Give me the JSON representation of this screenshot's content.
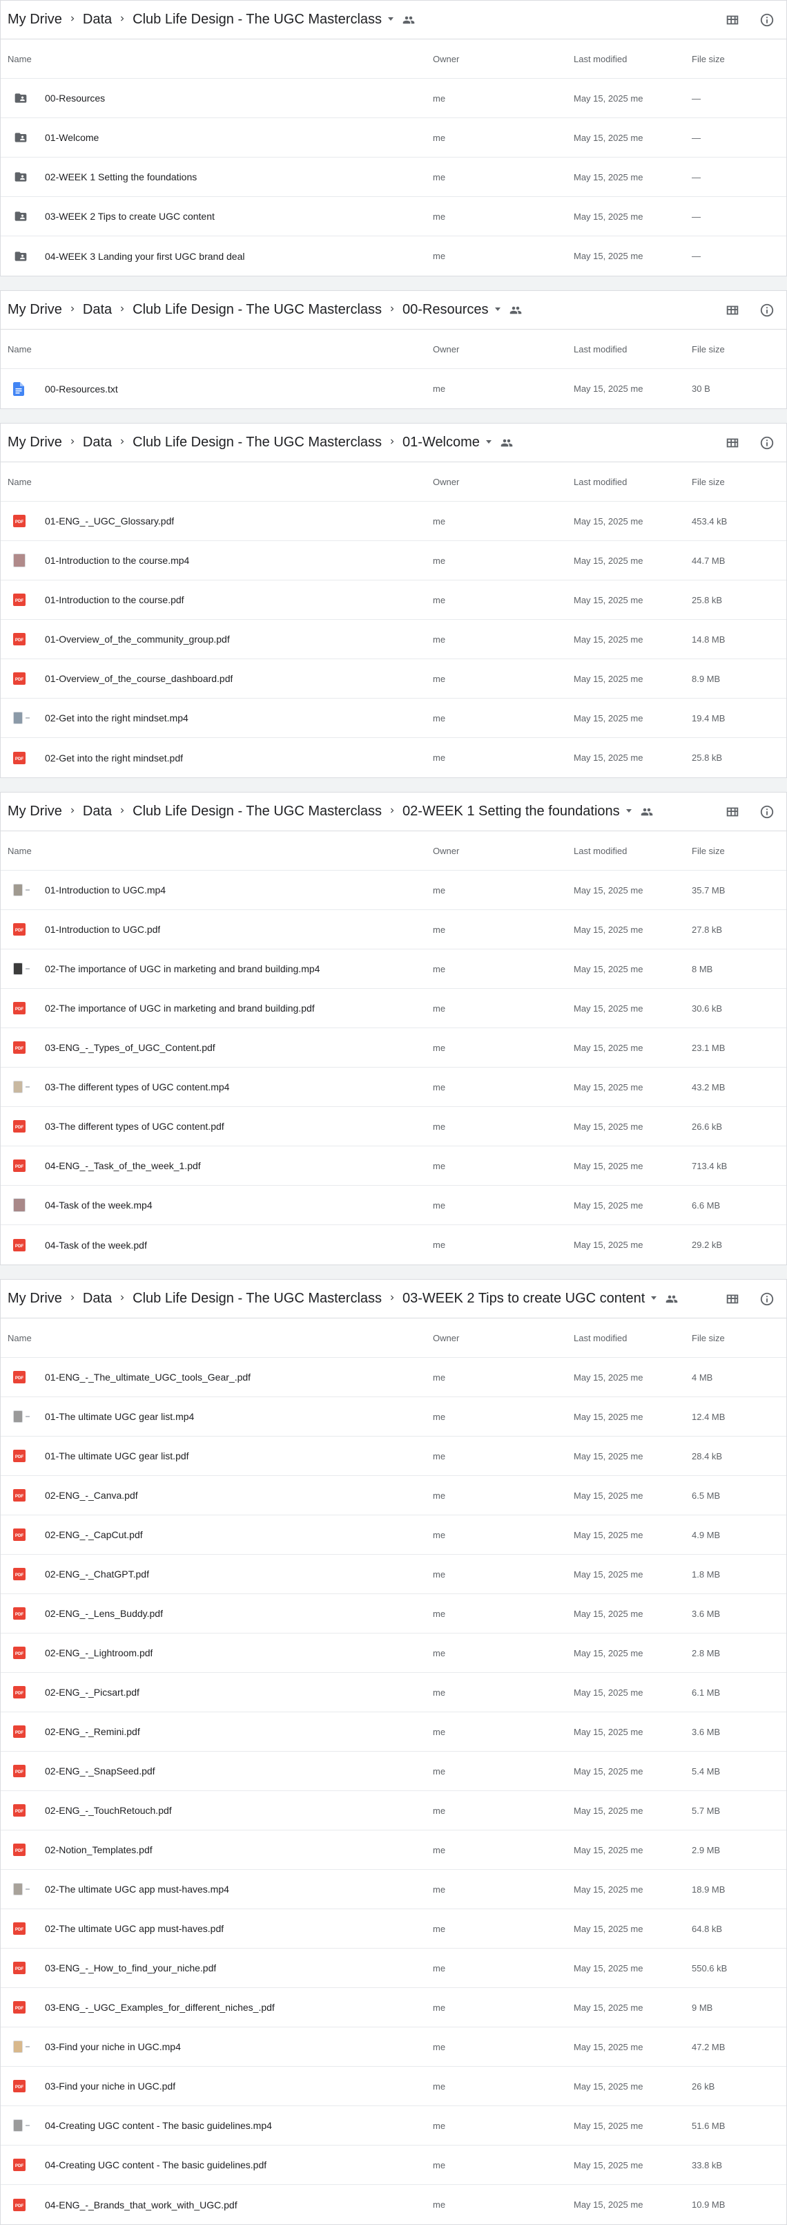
{
  "colors": {
    "pdf": "#ea4335",
    "doc": "#4285f4",
    "folder": "#5f6368",
    "text": "#202124",
    "muted": "#5f6368",
    "border": "#dadce0"
  },
  "columns": {
    "name": "Name",
    "owner": "Owner",
    "modified": "Last modified",
    "size": "File size"
  },
  "panels": [
    {
      "crumbs": [
        "My Drive",
        "Data",
        "Club Life Design - The UGC Masterclass"
      ],
      "files": [
        {
          "name": "00-Resources",
          "owner": "me",
          "modified": "May 15, 2025 me",
          "size": "—",
          "icon": "folder-shared-icon"
        },
        {
          "name": "01-Welcome",
          "owner": "me",
          "modified": "May 15, 2025 me",
          "size": "—",
          "icon": "folder-shared-icon"
        },
        {
          "name": "02-WEEK 1 Setting the foundations",
          "owner": "me",
          "modified": "May 15, 2025 me",
          "size": "—",
          "icon": "folder-shared-icon"
        },
        {
          "name": "03-WEEK 2 Tips to create UGC content",
          "owner": "me",
          "modified": "May 15, 2025 me",
          "size": "—",
          "icon": "folder-shared-icon"
        },
        {
          "name": "04-WEEK 3 Landing your first UGC brand deal",
          "owner": "me",
          "modified": "May 15, 2025 me",
          "size": "—",
          "icon": "folder-shared-icon"
        }
      ]
    },
    {
      "crumbs": [
        "My Drive",
        "Data",
        "Club Life Design - The UGC Masterclass",
        "00-Resources"
      ],
      "files": [
        {
          "name": "00-Resources.txt",
          "owner": "me",
          "modified": "May 15, 2025 me",
          "size": "30 B",
          "icon": "doc-icon"
        }
      ]
    },
    {
      "crumbs": [
        "My Drive",
        "Data",
        "Club Life Design - The UGC Masterclass",
        "01-Welcome"
      ],
      "files": [
        {
          "name": "01-ENG_-_UGC_Glossary.pdf",
          "owner": "me",
          "modified": "May 15, 2025 me",
          "size": "453.4 kB",
          "icon": "pdf-icon"
        },
        {
          "name": "01-Introduction to the course.mp4",
          "owner": "me",
          "modified": "May 15, 2025 me",
          "size": "44.7 MB",
          "icon": "video-thumb-icon",
          "thumb": "#b08a8a"
        },
        {
          "name": "01-Introduction to the course.pdf",
          "owner": "me",
          "modified": "May 15, 2025 me",
          "size": "25.8 kB",
          "icon": "pdf-icon"
        },
        {
          "name": "01-Overview_of_the_community_group.pdf",
          "owner": "me",
          "modified": "May 15, 2025 me",
          "size": "14.8 MB",
          "icon": "pdf-icon"
        },
        {
          "name": "01-Overview_of_the_course_dashboard.pdf",
          "owner": "me",
          "modified": "May 15, 2025 me",
          "size": "8.9 MB",
          "icon": "pdf-icon"
        },
        {
          "name": "02-Get into the right mindset.mp4",
          "owner": "me",
          "modified": "May 15, 2025 me",
          "size": "19.4 MB",
          "icon": "video-thumb-wide-icon",
          "thumb": "#8b9aa8"
        },
        {
          "name": "02-Get into the right mindset.pdf",
          "owner": "me",
          "modified": "May 15, 2025 me",
          "size": "25.8 kB",
          "icon": "pdf-icon"
        }
      ]
    },
    {
      "crumbs": [
        "My Drive",
        "Data",
        "Club Life Design - The UGC Masterclass",
        "02-WEEK 1 Setting the foundations"
      ],
      "files": [
        {
          "name": "01-Introduction to UGC.mp4",
          "owner": "me",
          "modified": "May 15, 2025 me",
          "size": "35.7 MB",
          "icon": "video-thumb-wide-icon",
          "thumb": "#a09a90"
        },
        {
          "name": "01-Introduction to UGC.pdf",
          "owner": "me",
          "modified": "May 15, 2025 me",
          "size": "27.8 kB",
          "icon": "pdf-icon"
        },
        {
          "name": "02-The importance of UGC in marketing and brand building.mp4",
          "owner": "me",
          "modified": "May 15, 2025 me",
          "size": "8 MB",
          "icon": "video-thumb-wide-icon",
          "thumb": "#3c3c3c"
        },
        {
          "name": "02-The importance of UGC in marketing and brand building.pdf",
          "owner": "me",
          "modified": "May 15, 2025 me",
          "size": "30.6 kB",
          "icon": "pdf-icon"
        },
        {
          "name": "03-ENG_-_Types_of_UGC_Content.pdf",
          "owner": "me",
          "modified": "May 15, 2025 me",
          "size": "23.1 MB",
          "icon": "pdf-icon"
        },
        {
          "name": "03-The different types of UGC content.mp4",
          "owner": "me",
          "modified": "May 15, 2025 me",
          "size": "43.2 MB",
          "icon": "video-thumb-wide-icon",
          "thumb": "#c8b8a0"
        },
        {
          "name": "03-The different types of UGC content.pdf",
          "owner": "me",
          "modified": "May 15, 2025 me",
          "size": "26.6 kB",
          "icon": "pdf-icon"
        },
        {
          "name": "04-ENG_-_Task_of_the_week_1.pdf",
          "owner": "me",
          "modified": "May 15, 2025 me",
          "size": "713.4 kB",
          "icon": "pdf-icon"
        },
        {
          "name": "04-Task of the week.mp4",
          "owner": "me",
          "modified": "May 15, 2025 me",
          "size": "6.6 MB",
          "icon": "video-thumb-icon",
          "thumb": "#a88888"
        },
        {
          "name": "04-Task of the week.pdf",
          "owner": "me",
          "modified": "May 15, 2025 me",
          "size": "29.2 kB",
          "icon": "pdf-icon"
        }
      ]
    },
    {
      "crumbs": [
        "My Drive",
        "Data",
        "Club Life Design - The UGC Masterclass",
        "03-WEEK 2 Tips to create UGC content"
      ],
      "files": [
        {
          "name": "01-ENG_-_The_ultimate_UGC_tools_Gear_.pdf",
          "owner": "me",
          "modified": "May 15, 2025 me",
          "size": "4 MB",
          "icon": "pdf-icon"
        },
        {
          "name": "01-The ultimate UGC gear list.mp4",
          "owner": "me",
          "modified": "May 15, 2025 me",
          "size": "12.4 MB",
          "icon": "video-thumb-wide-icon",
          "thumb": "#9a9a9a"
        },
        {
          "name": "01-The ultimate UGC gear list.pdf",
          "owner": "me",
          "modified": "May 15, 2025 me",
          "size": "28.4 kB",
          "icon": "pdf-icon"
        },
        {
          "name": "02-ENG_-_Canva.pdf",
          "owner": "me",
          "modified": "May 15, 2025 me",
          "size": "6.5 MB",
          "icon": "pdf-icon"
        },
        {
          "name": "02-ENG_-_CapCut.pdf",
          "owner": "me",
          "modified": "May 15, 2025 me",
          "size": "4.9 MB",
          "icon": "pdf-icon"
        },
        {
          "name": "02-ENG_-_ChatGPT.pdf",
          "owner": "me",
          "modified": "May 15, 2025 me",
          "size": "1.8 MB",
          "icon": "pdf-icon"
        },
        {
          "name": "02-ENG_-_Lens_Buddy.pdf",
          "owner": "me",
          "modified": "May 15, 2025 me",
          "size": "3.6 MB",
          "icon": "pdf-icon"
        },
        {
          "name": "02-ENG_-_Lightroom.pdf",
          "owner": "me",
          "modified": "May 15, 2025 me",
          "size": "2.8 MB",
          "icon": "pdf-icon"
        },
        {
          "name": "02-ENG_-_Picsart.pdf",
          "owner": "me",
          "modified": "May 15, 2025 me",
          "size": "6.1 MB",
          "icon": "pdf-icon"
        },
        {
          "name": "02-ENG_-_Remini.pdf",
          "owner": "me",
          "modified": "May 15, 2025 me",
          "size": "3.6 MB",
          "icon": "pdf-icon"
        },
        {
          "name": "02-ENG_-_SnapSeed.pdf",
          "owner": "me",
          "modified": "May 15, 2025 me",
          "size": "5.4 MB",
          "icon": "pdf-icon"
        },
        {
          "name": "02-ENG_-_TouchRetouch.pdf",
          "owner": "me",
          "modified": "May 15, 2025 me",
          "size": "5.7 MB",
          "icon": "pdf-icon"
        },
        {
          "name": "02-Notion_Templates.pdf",
          "owner": "me",
          "modified": "May 15, 2025 me",
          "size": "2.9 MB",
          "icon": "pdf-icon"
        },
        {
          "name": "02-The ultimate UGC app must-haves.mp4",
          "owner": "me",
          "modified": "May 15, 2025 me",
          "size": "18.9 MB",
          "icon": "video-thumb-wide-icon",
          "thumb": "#a8a29a"
        },
        {
          "name": "02-The ultimate UGC app must-haves.pdf",
          "owner": "me",
          "modified": "May 15, 2025 me",
          "size": "64.8 kB",
          "icon": "pdf-icon"
        },
        {
          "name": "03-ENG_-_How_to_find_your_niche.pdf",
          "owner": "me",
          "modified": "May 15, 2025 me",
          "size": "550.6 kB",
          "icon": "pdf-icon"
        },
        {
          "name": "03-ENG_-_UGC_Examples_for_different_niches_.pdf",
          "owner": "me",
          "modified": "May 15, 2025 me",
          "size": "9 MB",
          "icon": "pdf-icon"
        },
        {
          "name": "03-Find your niche in UGC.mp4",
          "owner": "me",
          "modified": "May 15, 2025 me",
          "size": "47.2 MB",
          "icon": "video-thumb-wide-icon",
          "thumb": "#d8b88c"
        },
        {
          "name": "03-Find your niche in UGC.pdf",
          "owner": "me",
          "modified": "May 15, 2025 me",
          "size": "26 kB",
          "icon": "pdf-icon"
        },
        {
          "name": "04-Creating UGC content - The basic guidelines.mp4",
          "owner": "me",
          "modified": "May 15, 2025 me",
          "size": "51.6 MB",
          "icon": "video-thumb-wide-icon",
          "thumb": "#9a9a9a"
        },
        {
          "name": "04-Creating UGC content - The basic guidelines.pdf",
          "owner": "me",
          "modified": "May 15, 2025 me",
          "size": "33.8 kB",
          "icon": "pdf-icon"
        },
        {
          "name": "04-ENG_-_Brands_that_work_with_UGC.pdf",
          "owner": "me",
          "modified": "May 15, 2025 me",
          "size": "10.9 MB",
          "icon": "pdf-icon"
        }
      ]
    }
  ]
}
